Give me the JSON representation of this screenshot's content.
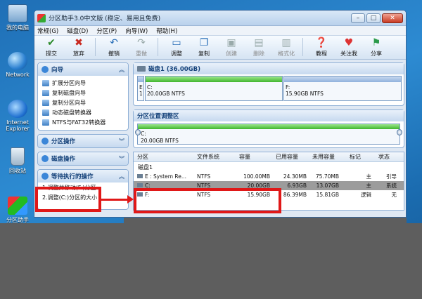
{
  "desktop": {
    "icons": [
      {
        "name": "我的电脑",
        "icon": "computer-icon"
      },
      {
        "name": "Network",
        "icon": "network-icon"
      },
      {
        "name": "Internet Explorer",
        "icon": "ie-icon"
      },
      {
        "name": "回收站",
        "icon": "recycle-bin-icon"
      },
      {
        "name": "分区助手",
        "icon": "partition-app-icon"
      }
    ]
  },
  "window": {
    "title": "分区助手3.0中文版 (稳定、易用且免费)",
    "controls": [
      "–",
      "□",
      "✕"
    ]
  },
  "menu": [
    "常规(G)",
    "磁盘(D)",
    "分区(P)",
    "向导(W)",
    "帮助(H)"
  ],
  "toolbar": [
    {
      "label": "提交",
      "icon": "check-icon",
      "enabled": true
    },
    {
      "label": "放弃",
      "icon": "discard-icon",
      "enabled": true
    },
    {
      "label": "撤销",
      "icon": "undo-icon",
      "enabled": true
    },
    {
      "label": "重做",
      "icon": "redo-icon",
      "enabled": false
    },
    {
      "label": "调整",
      "icon": "resize-icon",
      "enabled": true
    },
    {
      "label": "复制",
      "icon": "copy-icon",
      "enabled": true
    },
    {
      "label": "创建",
      "icon": "create-icon",
      "enabled": false
    },
    {
      "label": "删除",
      "icon": "delete-icon",
      "enabled": false
    },
    {
      "label": "格式化",
      "icon": "format-icon",
      "enabled": false
    },
    {
      "label": "教程",
      "icon": "tutorial-icon",
      "enabled": true
    },
    {
      "label": "关注我",
      "icon": "follow-icon",
      "enabled": true
    },
    {
      "label": "分享",
      "icon": "share-icon",
      "enabled": true
    }
  ],
  "sidebar": {
    "wizard": {
      "title": "向导",
      "items": [
        "扩展分区向导",
        "复制磁盘向导",
        "复制分区向导",
        "动态磁盘转换器",
        "NTFS与FAT32转换器"
      ]
    },
    "partition_ops": "分区操作",
    "disk_ops": "磁盘操作",
    "pending": {
      "title": "等待执行的操作",
      "items": [
        "1.调整并移动(F:)分区",
        "2.调整(C:)分区的大小"
      ]
    }
  },
  "disk_map": {
    "title": "磁盘1 (36.00GB)",
    "segments": [
      {
        "top": "E",
        "bottom": "1"
      },
      {
        "top": "C:",
        "bottom": "20.00GB NTFS"
      },
      {
        "top": "F:",
        "bottom": "15.90GB NTFS"
      }
    ]
  },
  "adjust": {
    "title": "分区位置调整区",
    "label": "C:",
    "size": "20.00GB NTFS"
  },
  "table": {
    "headers": [
      "分区",
      "文件系统",
      "容量",
      "已用容量",
      "未用容量",
      "标记",
      "状态"
    ],
    "group": "磁盘1",
    "rows": [
      {
        "name": "E : System Re...",
        "fs": "NTFS",
        "cap": "100.00MB",
        "used": "24.30MB",
        "free": "75.70MB",
        "flag": "主",
        "status": "引导"
      },
      {
        "name": "C:",
        "fs": "NTFS",
        "cap": "20.00GB",
        "used": "6.93GB",
        "free": "13.07GB",
        "flag": "主",
        "status": "系统"
      },
      {
        "name": "F:",
        "fs": "NTFS",
        "cap": "15.90GB",
        "used": "86.39MB",
        "free": "15.81GB",
        "flag": "逻辑",
        "status": "无"
      }
    ]
  },
  "colors": {
    "used_bar": "#3fb52d",
    "free_bar": "#8fb2dc",
    "annotation": "#e01818",
    "overlay": "#5e5e5e"
  }
}
